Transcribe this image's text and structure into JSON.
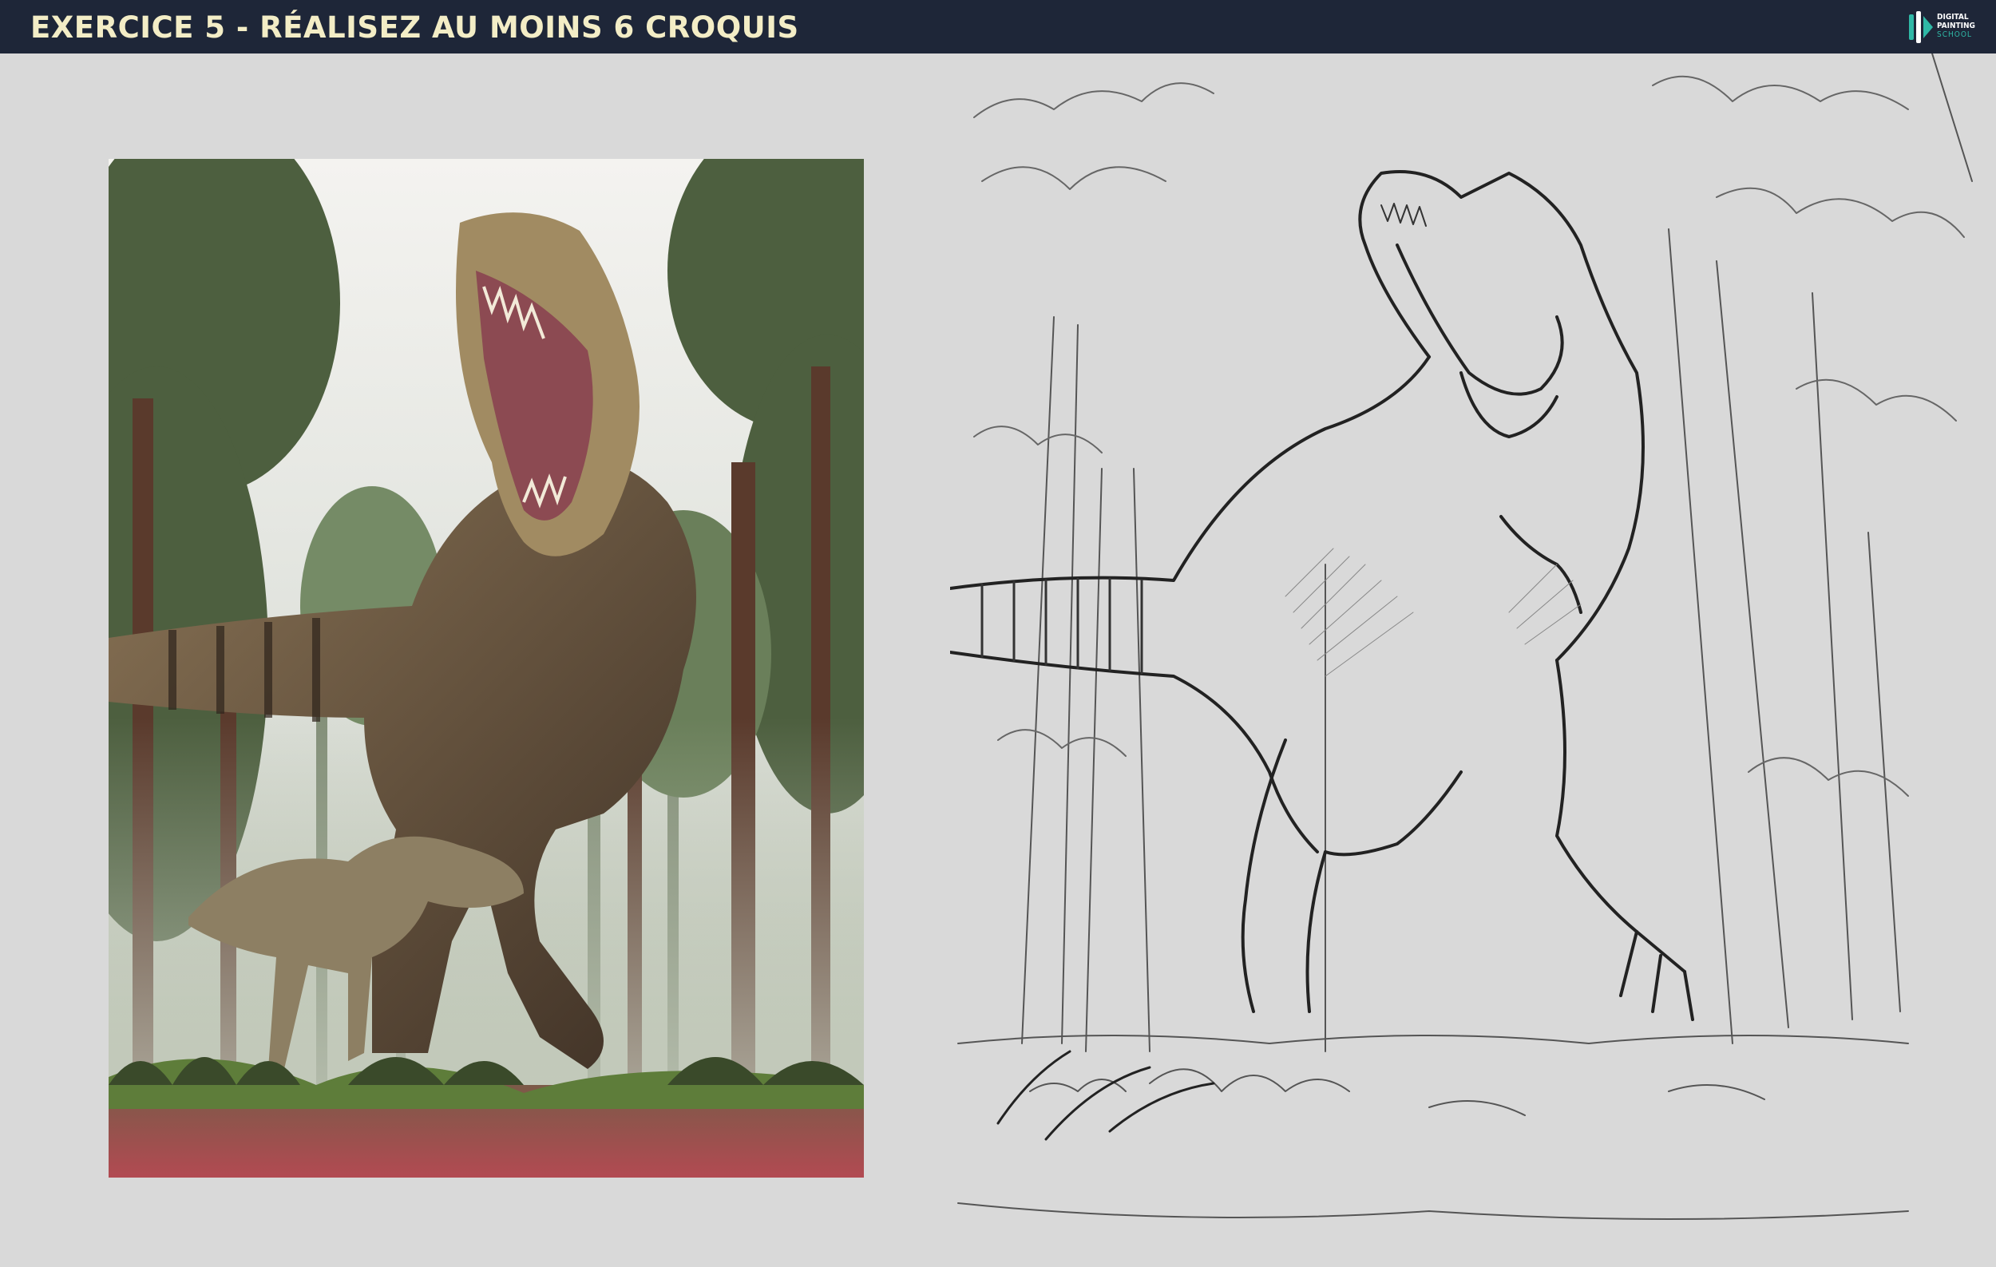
{
  "header": {
    "title": "EXERCICE 5 - RÉALISEZ AU MOINS 6 CROQUIS",
    "logo": {
      "line1": "DIGITAL",
      "line2": "PAINTING",
      "line3": "SCHOOL",
      "icon": "brush-logo-icon"
    }
  },
  "colors": {
    "header_bg": "#1e2638",
    "title_text": "#f3edc6",
    "page_bg": "#d9d9d9",
    "logo_accent": "#2fb8a6"
  },
  "reference_image": {
    "icon": "tyrannosaurus-photo"
  },
  "sketch_image": {
    "icon": "tyrannosaurus-line-sketch"
  }
}
